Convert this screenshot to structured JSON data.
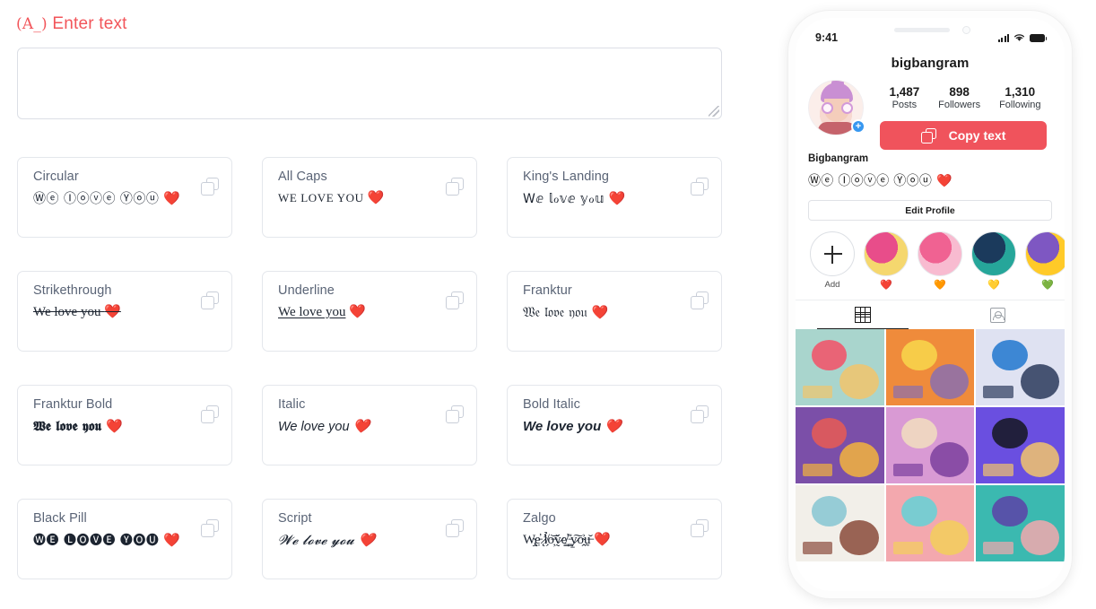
{
  "editor": {
    "label": "(A_) Enter text",
    "label_prefix": "(A_)",
    "label_main": "Enter text",
    "textarea_value": "",
    "textarea_placeholder": "",
    "accent_color": "#f2555a"
  },
  "styles": [
    {
      "name": "Circular",
      "sample": "Ⓦⓔ Ⓘⓞⓥⓔ Ⓨⓞⓤ",
      "variant": "s-unicode",
      "copy_label": "copy-icon"
    },
    {
      "name": "All Caps",
      "sample": "WE LOVE YOU",
      "variant": "s-smallcaps",
      "copy_label": "copy-icon"
    },
    {
      "name": "King's Landing",
      "sample": "Wⅇ 𝕝ℴ𝕧ⅇ 𝕪ℴ𝕦",
      "variant": "s-unicode",
      "copy_label": "copy-icon"
    },
    {
      "name": "Strikethrough",
      "sample": "We love you",
      "variant": "s-strike",
      "copy_label": "copy-icon"
    },
    {
      "name": "Underline",
      "sample": "We love you",
      "variant": "s-under",
      "copy_label": "copy-icon"
    },
    {
      "name": "Franktur",
      "sample": "𝔚𝔢 𝔩𝔬𝔳𝔢 𝔶𝔬𝔲",
      "variant": "s-fraktur",
      "copy_label": "copy-icon"
    },
    {
      "name": "Franktur Bold",
      "sample": "𝖂𝖊 𝖑𝖔𝖛𝖊 𝖞𝖔𝖚",
      "variant": "s-frakturb",
      "copy_label": "copy-icon"
    },
    {
      "name": "Italic",
      "sample": "We love you",
      "variant": "s-italic",
      "copy_label": "copy-icon"
    },
    {
      "name": "Bold Italic",
      "sample": "We love you",
      "variant": "s-bolditalic",
      "copy_label": "copy-icon"
    },
    {
      "name": "Black Pill",
      "sample": "🅦🅔 🅛🅞🅥🅔 🅨🅞🅤",
      "variant": "s-unicode",
      "copy_label": "copy-icon"
    },
    {
      "name": "Script",
      "sample": "𝓦𝓮 𝓵𝓸𝓿𝓮 𝔂𝓸𝓾",
      "variant": "s-script",
      "copy_label": "copy-icon"
    },
    {
      "name": "Zalgo",
      "sample": "W̴̢̡e̵̤̓ ̷̨̛l̸̗̉o̶̦͝v̷̰̌e̸͇̕ ̵̪̎y̷̱͠o̴̭͐ṵ̶̆",
      "variant": "s-zalgo",
      "copy_label": "copy-icon"
    }
  ],
  "sample_heart": "❤️",
  "phone": {
    "status": {
      "time": "9:41",
      "signal": "signal-icon",
      "wifi": "wifi-icon",
      "battery": "battery-icon"
    },
    "title": "bigbangram",
    "stats": [
      {
        "value": "1,487",
        "label": "Posts"
      },
      {
        "value": "898",
        "label": "Followers"
      },
      {
        "value": "1,310",
        "label": "Following"
      }
    ],
    "copy_button": {
      "label": "Copy text",
      "color": "#f0535c"
    },
    "profile_name": "Bigbangram",
    "bio_text": "Ⓦⓔ Ⓘⓞⓥⓔ Ⓨⓞⓤ ❤️",
    "edit_profile_label": "Edit Profile",
    "avatar_badge": "+",
    "stories": [
      {
        "label": "Add",
        "heart": "",
        "type": "add"
      },
      {
        "label": "",
        "heart": "❤️",
        "color1": "#e84d8a",
        "color2": "#f5d76e",
        "type": "story"
      },
      {
        "label": "",
        "heart": "🧡",
        "color1": "#f06292",
        "color2": "#f8bbd0",
        "type": "story"
      },
      {
        "label": "",
        "heart": "💛",
        "color1": "#1b3a5c",
        "color2": "#26a69a",
        "type": "story"
      },
      {
        "label": "",
        "heart": "💚",
        "color1": "#7e57c2",
        "color2": "#ffca28",
        "type": "story"
      }
    ],
    "tabs": [
      {
        "icon": "grid-icon",
        "active": true
      },
      {
        "icon": "tagged-icon",
        "active": false
      }
    ],
    "photos": [
      {
        "bg": "#a9d5cd",
        "accent": "#ef5a6f",
        "accent2": "#f2c46b"
      },
      {
        "bg": "#ef8b3b",
        "accent": "#f7d14b",
        "accent2": "#8a6fb0"
      },
      {
        "bg": "#dfe2f2",
        "accent": "#2f7fd1",
        "accent2": "#2b3a5c"
      },
      {
        "bg": "#7b4fa8",
        "accent": "#e05a5a",
        "accent2": "#f3b33d"
      },
      {
        "bg": "#d99ad4",
        "accent": "#f0d9c0",
        "accent2": "#7b3f9e"
      },
      {
        "bg": "#6a4fe0",
        "accent": "#1b1b2e",
        "accent2": "#f2c46b"
      },
      {
        "bg": "#f2efe9",
        "accent": "#8ec9d4",
        "accent2": "#8a4a3a"
      },
      {
        "bg": "#f3a8ae",
        "accent": "#6fcfd4",
        "accent2": "#f2cf5b"
      },
      {
        "bg": "#3bb9b0",
        "accent": "#5a4aa8",
        "accent2": "#f3a8ae"
      }
    ]
  }
}
